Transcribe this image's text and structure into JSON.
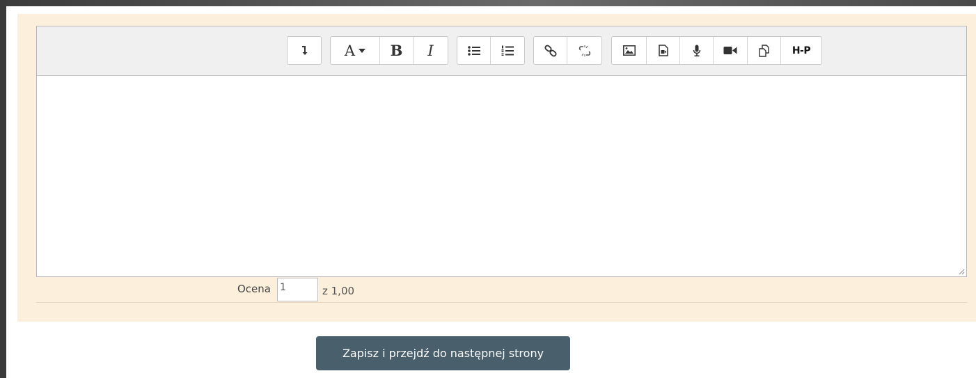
{
  "toolbar": {
    "font_label": "A",
    "bold_label": "B",
    "italic_label": "I",
    "h5p_label": "H-P"
  },
  "grade": {
    "label": "Ocena",
    "value": "1",
    "max_label": "z 1,00"
  },
  "actions": {
    "submit_label": "Zapisz i przejdź do następnej strony"
  },
  "colors": {
    "panel_background": "#fcefdc",
    "toolbar_background": "#f0f0f0",
    "submit_background": "#495f6b"
  },
  "icons": [
    "show-more-icon",
    "font-icon",
    "bold-icon",
    "italic-icon",
    "unordered-list-icon",
    "ordered-list-icon",
    "link-icon",
    "unlink-icon",
    "image-icon",
    "media-icon",
    "microphone-icon",
    "video-icon",
    "manage-files-icon",
    "h5p-icon"
  ]
}
